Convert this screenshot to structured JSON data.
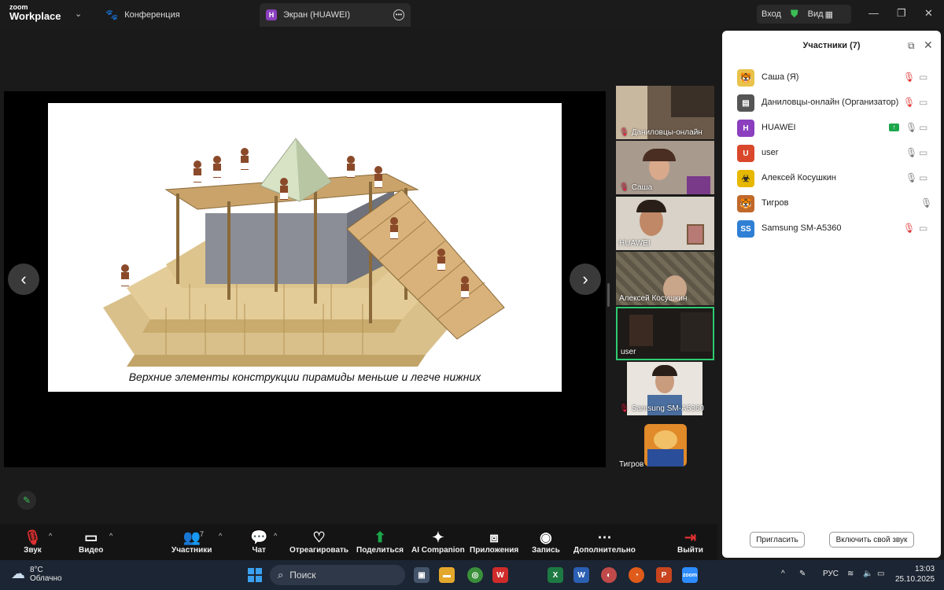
{
  "app": {
    "logo_small": "zoom",
    "logo_main": "Workplace"
  },
  "tabs": [
    {
      "label": "Конференция"
    },
    {
      "label": "Экран (HUAWEI)",
      "badge": "H"
    }
  ],
  "titlebar": {
    "signin": "Вход",
    "view": "Вид"
  },
  "slide": {
    "caption": "Верхние элементы конструкции пирамиды меньше и легче нижних"
  },
  "gallery": [
    {
      "name": "Даниловцы-онлайн",
      "muted": true
    },
    {
      "name": "Саша",
      "muted": true
    },
    {
      "name": "HUAWEI",
      "muted": false
    },
    {
      "name": "Алексей Косушкин",
      "muted": false
    },
    {
      "name": "user",
      "muted": false,
      "active": true
    },
    {
      "name": "Samsung SM-A5360",
      "muted": true
    },
    {
      "name": "Тигров",
      "muted": false
    }
  ],
  "participants": {
    "title": "Участники (7)",
    "list": [
      {
        "name": "Саша (Я)",
        "avatar": "",
        "avatar_color": "#e8c24a",
        "mic": "off",
        "cam": "off"
      },
      {
        "name": "Даниловцы-онлайн (Организатор)",
        "avatar": "",
        "avatar_color": "#555555",
        "mic": "off",
        "cam": "off"
      },
      {
        "name": "HUAWEI",
        "avatar": "H",
        "avatar_color": "#8b3fbf",
        "mic": "on",
        "cam": "off",
        "sharing": true
      },
      {
        "name": "user",
        "avatar": "U",
        "avatar_color": "#d9482b",
        "mic": "on",
        "cam": "off"
      },
      {
        "name": "Алексей Косушкин",
        "avatar": "",
        "avatar_color": "#e6b800",
        "mic": "on",
        "cam": "off"
      },
      {
        "name": "Тигров",
        "avatar": "",
        "avatar_color": "#c0692a",
        "mic": "on",
        "cam": "none"
      },
      {
        "name": "Samsung SM-A5360",
        "avatar": "SS",
        "avatar_color": "#2f7fd4",
        "mic": "off",
        "cam": "off"
      }
    ],
    "invite_label": "Пригласить",
    "unmute_label": "Включить свой звук"
  },
  "toolbar": {
    "audio": "Звук",
    "video": "Видео",
    "participants": "Участники",
    "participants_count": "7",
    "chat": "Чат",
    "react": "Отреагировать",
    "share": "Поделиться",
    "ai": "AI Companion",
    "apps": "Приложения",
    "record": "Запись",
    "more": "Дополнительно",
    "leave": "Выйти"
  },
  "taskbar": {
    "temp": "8°C",
    "weather": "Облачно",
    "search": "Поиск",
    "lang": "РУС",
    "time": "13:03",
    "date": "25.10.2025"
  }
}
